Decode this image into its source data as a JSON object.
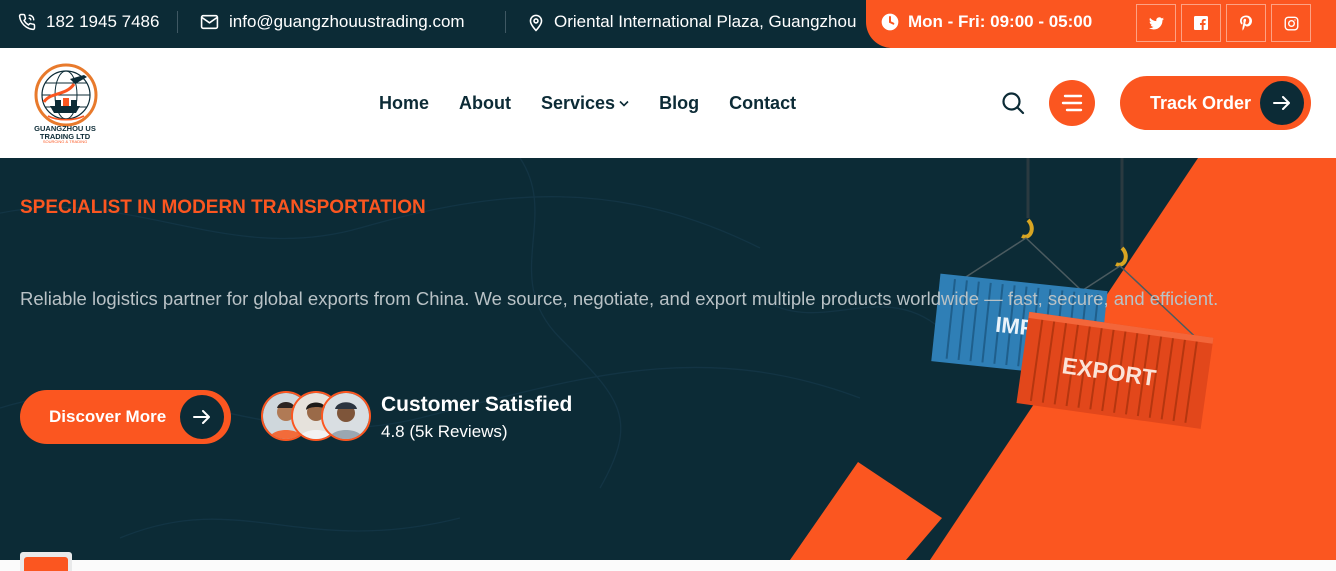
{
  "topbar": {
    "phone": "182 1945 7486",
    "email": "info@guangzhouustrading.com",
    "address": "Oriental International Plaza, Guangzhou",
    "hours": "Mon - Fri: 09:00 - 05:00",
    "socials": [
      "twitter-icon",
      "facebook-icon",
      "pinterest-icon",
      "instagram-icon"
    ]
  },
  "header": {
    "logo": {
      "line1": "GUANGZHOU US",
      "line2": "TRADING LTD",
      "line3": "SOURCING & TRADING"
    },
    "nav": [
      "Home",
      "About",
      "Services",
      "Blog",
      "Contact"
    ],
    "track_label": "Track Order"
  },
  "hero": {
    "tagline": "SPECIALIST IN MODERN TRANSPORTATION",
    "description": "Reliable logistics partner for global exports from China. We source, negotiate, and export multiple products worldwide — fast, secure, and efficient.",
    "discover_label": "Discover More",
    "satisfaction": {
      "title": "Customer Satisfied",
      "rating": "4.8 (5k Reviews)"
    },
    "containers": {
      "left_label": "IMP",
      "right_label": "EXPORT"
    }
  },
  "colors": {
    "navy": "#0c2b36",
    "accent": "#fb5620",
    "white": "#ffffff"
  }
}
